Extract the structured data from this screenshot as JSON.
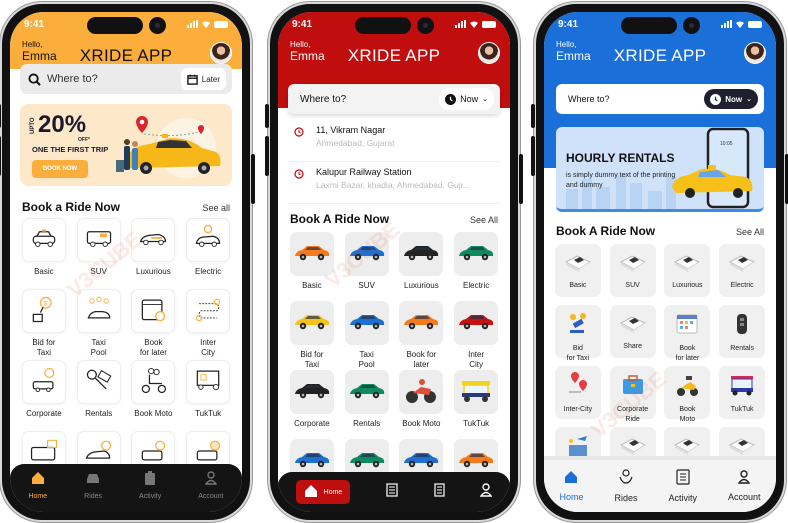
{
  "phones": [
    {
      "theme": "orange",
      "accent": "#fbae3c",
      "status_time": "9:41",
      "greeting": "Hello,",
      "user_name": "Emma",
      "app_title": "XRIDE APP",
      "search_placeholder": "Where to?",
      "schedule_button": "Later",
      "promo": {
        "upto": "UPTO",
        "percent": "20%",
        "off": "OFF*",
        "headline": "ONE THE FIRST TRIP",
        "cta": "BOOK NOW"
      },
      "section_title": "Book a Ride Now",
      "see_all": "See all",
      "services": [
        "Basic",
        "SUV",
        "Luxurious",
        "Electric",
        "Bid for\nTaxi",
        "Taxi\nPool",
        "Book\nfor later",
        "Inter\nCity",
        "Corporate",
        "Rentals",
        "Book Moto",
        "TukTuk",
        "",
        "",
        "",
        ""
      ],
      "nav": [
        {
          "label": "Home",
          "icon": "home-icon",
          "active": true
        },
        {
          "label": "Rides",
          "icon": "car-icon",
          "active": false
        },
        {
          "label": "Activity",
          "icon": "clipboard-icon",
          "active": false
        },
        {
          "label": "Account",
          "icon": "user-icon",
          "active": false
        }
      ]
    },
    {
      "theme": "red",
      "accent": "#c00d0d",
      "status_time": "9:41",
      "greeting": "Hello,",
      "user_name": "Emma",
      "app_title": "XRIDE APP",
      "search_placeholder": "Where to?",
      "schedule_button": "Now",
      "recent_places": [
        {
          "title": "11, Vikram Nagar",
          "subtitle": "Ahmedabad, Gujarat"
        },
        {
          "title": "Kalupur Railway Station",
          "subtitle": "Laxmi Bazar, khadia, Ahmedabad, Gujr..."
        }
      ],
      "section_title": "Book A Ride Now",
      "see_all": "See All",
      "services": [
        "Basic",
        "SUV",
        "Luxurious",
        "Electric",
        "Bid for\nTaxi",
        "Taxi\nPool",
        "Book for\nlater",
        "Inter\nCity",
        "Corporate",
        "Rentals",
        "Book Moto",
        "TukTuk",
        "",
        "",
        "",
        ""
      ],
      "service_colors": [
        "#f47a1c",
        "#1e6fd0",
        "#222222",
        "#0e8a5f",
        "#f4c21c",
        "#1e6fd0",
        "#f47a1c",
        "#c81010",
        "#222222",
        "#0e8a5f",
        "#e14f3c",
        "#f4d21c",
        "#1e6fd0",
        "#0e8a5f",
        "#1e6fd0",
        "#f47a1c"
      ],
      "nav": [
        {
          "label": "Home",
          "icon": "home-icon",
          "active": true
        },
        {
          "label": "",
          "icon": "list-icon",
          "active": false
        },
        {
          "label": "",
          "icon": "document-icon",
          "active": false
        },
        {
          "label": "",
          "icon": "user-icon",
          "active": false
        }
      ]
    },
    {
      "theme": "blue",
      "accent": "#1a6fd8",
      "status_time": "9:41",
      "greeting": "Hello,",
      "user_name": "Emma",
      "app_title": "XRIDE APP",
      "search_placeholder": "Where to?",
      "schedule_button": "Now",
      "banner": {
        "title": "HOURLY RENTALS",
        "body": "is simply dummy text of the printing and dummy",
        "phone_time": "10:05"
      },
      "section_title": "Book A Ride Now",
      "see_all": "See All",
      "services": [
        "Basic",
        "SUV",
        "Luxurious",
        "Electric",
        "Bid\nfor Taxi",
        "Share",
        "Book\nfor later",
        "Rentals",
        "Inter-City",
        "Corporate\nRide",
        "Book\nMoto",
        "TukTuk",
        "",
        "",
        "",
        ""
      ],
      "nav": [
        {
          "label": "Home",
          "icon": "home-icon",
          "active": true
        },
        {
          "label": "Rides",
          "icon": "rides-icon",
          "active": false
        },
        {
          "label": "Activity",
          "icon": "checklist-icon",
          "active": false
        },
        {
          "label": "Account",
          "icon": "user-icon",
          "active": false
        }
      ]
    }
  ],
  "watermark": "V3CUBE"
}
